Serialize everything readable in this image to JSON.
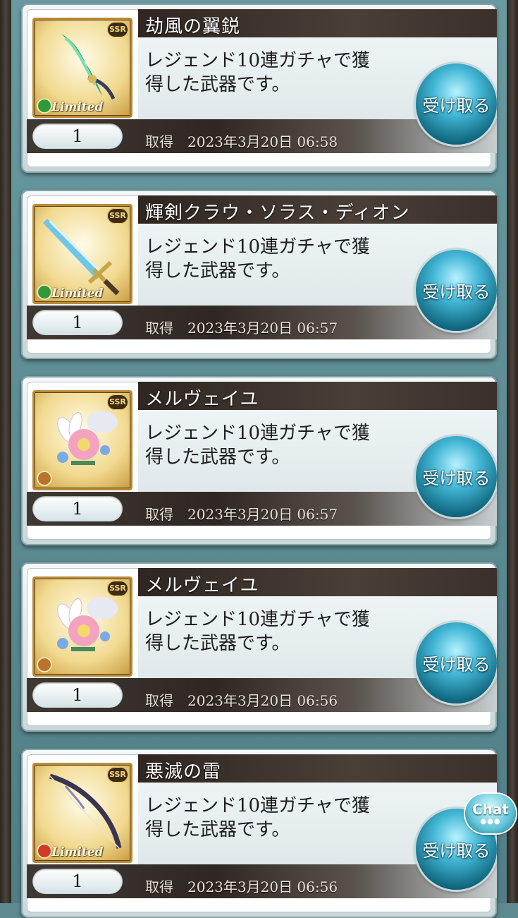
{
  "items": [
    {
      "name": "劫風の翼鋭",
      "desc_line1": "レジェンド10連ガチャで獲",
      "desc_line2": "得した武器です。",
      "rarity": "SSR",
      "limited": "Limited",
      "element_color": "#2f9a3c",
      "icon": "wind-wing-weapon-icon",
      "qty": "1",
      "obtained_label": "取得",
      "obtained_date": "2023年3月20日 06:58",
      "button_label": "受け取る"
    },
    {
      "name": "輝剣クラウ・ソラス・ディオン",
      "desc_line1": "レジェンド10連ガチャで獲",
      "desc_line2": "得した武器です。",
      "rarity": "SSR",
      "limited": "Limited",
      "element_color": "#2f9a3c",
      "icon": "sword-weapon-icon",
      "qty": "1",
      "obtained_label": "取得",
      "obtained_date": "2023年3月20日 06:57",
      "button_label": "受け取る"
    },
    {
      "name": "メルヴェイユ",
      "desc_line1": "レジェンド10連ガチャで獲",
      "desc_line2": "得した武器です。",
      "rarity": "SSR",
      "limited": "",
      "element_color": "#b8742c",
      "icon": "flower-bouquet-weapon-icon",
      "qty": "1",
      "obtained_label": "取得",
      "obtained_date": "2023年3月20日 06:57",
      "button_label": "受け取る"
    },
    {
      "name": "メルヴェイユ",
      "desc_line1": "レジェンド10連ガチャで獲",
      "desc_line2": "得した武器です。",
      "rarity": "SSR",
      "limited": "",
      "element_color": "#b8742c",
      "icon": "flower-bouquet-weapon-icon",
      "qty": "1",
      "obtained_label": "取得",
      "obtained_date": "2023年3月20日 06:56",
      "button_label": "受け取る"
    },
    {
      "name": "悪滅の雷",
      "desc_line1": "レジェンド10連ガチャで獲",
      "desc_line2": "得した武器です。",
      "rarity": "SSR",
      "limited": "Limited",
      "element_color": "#d23a2a",
      "icon": "bow-weapon-icon",
      "qty": "1",
      "obtained_label": "取得",
      "obtained_date": "2023年3月20日 06:56",
      "button_label": "受け取る"
    }
  ],
  "chat": {
    "label": "Chat"
  }
}
